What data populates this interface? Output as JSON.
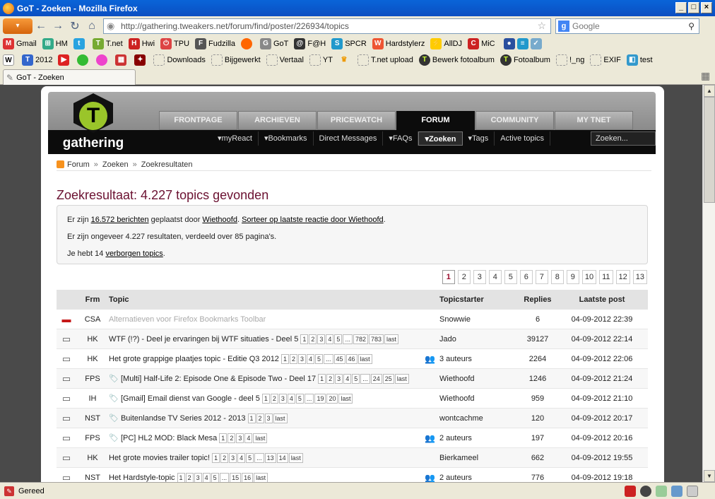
{
  "window": {
    "title": "GoT - Zoeken - Mozilla Firefox"
  },
  "nav": {
    "url": "http://gathering.tweakers.net/forum/find/poster/226934/topics",
    "search_placeholder": "Google"
  },
  "bookmarks_row1": [
    "Gmail",
    "HM",
    "",
    "T.net",
    "Hwi",
    "TPU",
    "Fudzilla",
    "",
    "GoT",
    "F@H",
    "SPCR",
    "Hardstylerz",
    "AllDJ",
    "MiC"
  ],
  "bookmarks_row2": [
    "",
    "2012",
    "",
    "",
    "",
    "",
    "",
    "Downloads",
    "Bijgewerkt",
    "Vertaal",
    "YT",
    "",
    "T.net upload",
    "Bewerk fotoalbum",
    "Fotoalbum",
    "!_ng",
    "EXIF",
    "test"
  ],
  "tab": {
    "label": "GoT - Zoeken"
  },
  "status": {
    "text": "Gereed"
  },
  "site": {
    "logo_text": "gathering",
    "tabs": [
      "FRONTPAGE",
      "ARCHIEVEN",
      "PRICEWATCH",
      "FORUM",
      "COMMUNITY",
      "MY TNET"
    ],
    "subnav": [
      "myReact",
      "Bookmarks",
      "Direct Messages",
      "FAQs",
      "Zoeken",
      "Tags",
      "Active topics"
    ],
    "search_placeholder": "Zoeken..."
  },
  "breadcrumb": [
    "Forum",
    "Zoeken",
    "Zoekresultaten"
  ],
  "heading": "Zoekresultaat: 4.227 topics gevonden",
  "info": {
    "l1_pre": "Er zijn ",
    "l1_link1": "16.572 berichten",
    "l1_mid": " geplaatst door ",
    "l1_link2": "Wiethoofd",
    "l1_dot": ". ",
    "l1_link3": "Sorteer op laatste reactie door Wiethoofd",
    "l1_end": ".",
    "l2": "Er zijn ongeveer 4.227 resultaten, verdeeld over 85 pagina's.",
    "l3_pre": "Je hebt 14 ",
    "l3_link": "verborgen topics",
    "l3_end": "."
  },
  "pages": [
    "1",
    "2",
    "3",
    "4",
    "5",
    "6",
    "7",
    "8",
    "9",
    "10",
    "11",
    "12",
    "13"
  ],
  "table": {
    "headers": {
      "frm": "Frm",
      "topic": "Topic",
      "starter": "Topicstarter",
      "replies": "Replies",
      "last": "Laatste post"
    },
    "rows": [
      {
        "frm": "CSA",
        "topic": "Alternatieven voor Firefox Bookmarks Toolbar",
        "pages": [],
        "starter": "Snowwie",
        "replies": "6",
        "last": "04-09-2012 22:39"
      },
      {
        "frm": "HK",
        "topic": "WTF (!?) - Deel je ervaringen bij WTF situaties - Deel 5",
        "pages": [
          "1",
          "2",
          "3",
          "4",
          "5",
          "...",
          "782",
          "783",
          "last"
        ],
        "starter": "Jado",
        "replies": "39127",
        "last": "04-09-2012 22:14"
      },
      {
        "frm": "HK",
        "topic": "Het grote grappige plaatjes topic - Editie Q3 2012",
        "pages": [
          "1",
          "2",
          "3",
          "4",
          "5",
          "...",
          "45",
          "46",
          "last"
        ],
        "starter": "3 auteurs",
        "replies": "2264",
        "last": "04-09-2012 22:06"
      },
      {
        "frm": "FPS",
        "topic": "[Multi] Half-Life 2: Episode One & Episode Two - Deel 17",
        "pages": [
          "1",
          "2",
          "3",
          "4",
          "5",
          "...",
          "24",
          "25",
          "last"
        ],
        "starter": "Wiethoofd",
        "replies": "1246",
        "last": "04-09-2012 21:24"
      },
      {
        "frm": "IH",
        "topic": "[Gmail] Email dienst van Google - deel 5",
        "pages": [
          "1",
          "2",
          "3",
          "4",
          "5",
          "...",
          "19",
          "20",
          "last"
        ],
        "starter": "Wiethoofd",
        "replies": "959",
        "last": "04-09-2012 21:10"
      },
      {
        "frm": "NST",
        "topic": "Buitenlandse TV Series 2012 - 2013",
        "pages": [
          "1",
          "2",
          "3",
          "last"
        ],
        "starter": "wontcachme",
        "replies": "120",
        "last": "04-09-2012 20:17"
      },
      {
        "frm": "FPS",
        "topic": "[PC] HL2 MOD: Black Mesa",
        "pages": [
          "1",
          "2",
          "3",
          "4",
          "last"
        ],
        "starter": "2 auteurs",
        "replies": "197",
        "last": "04-09-2012 20:16"
      },
      {
        "frm": "HK",
        "topic": "Het grote movies trailer topic!",
        "pages": [
          "1",
          "2",
          "3",
          "4",
          "5",
          "...",
          "13",
          "14",
          "last"
        ],
        "starter": "Bierkameel",
        "replies": "662",
        "last": "04-09-2012 19:55"
      },
      {
        "frm": "NST",
        "topic": "Het Hardstyle-topic",
        "pages": [
          "1",
          "2",
          "3",
          "4",
          "5",
          "...",
          "15",
          "16",
          "last"
        ],
        "starter": "2 auteurs",
        "replies": "776",
        "last": "04-09-2012 19:18"
      }
    ]
  }
}
